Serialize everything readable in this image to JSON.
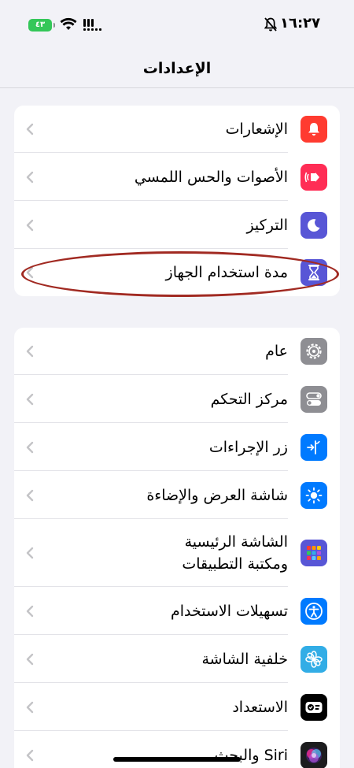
{
  "status": {
    "time": "١٦:٢٧",
    "battery": "٤٣"
  },
  "nav": {
    "title": "الإعدادات"
  },
  "groups": [
    {
      "items": [
        {
          "label": "الإشعارات",
          "icon": "bell-icon",
          "color": "#ff3b30"
        },
        {
          "label": "الأصوات والحس اللمسي",
          "icon": "speaker-icon",
          "color": "#ff2d55"
        },
        {
          "label": "التركيز",
          "icon": "moon-icon",
          "color": "#5856d6"
        },
        {
          "label": "مدة استخدام الجهاز",
          "icon": "hourglass-icon",
          "color": "#5856d6"
        }
      ]
    },
    {
      "items": [
        {
          "label": "عام",
          "icon": "gear-icon",
          "color": "#8e8e93"
        },
        {
          "label": "مركز التحكم",
          "icon": "toggles-icon",
          "color": "#8e8e93"
        },
        {
          "label": "زر الإجراءات",
          "icon": "action-button-icon",
          "color": "#007aff"
        },
        {
          "label": "شاشة العرض والإضاءة",
          "icon": "sun-icon",
          "color": "#007aff"
        },
        {
          "label": "الشاشة الرئيسية ومكتبة التطبيقات",
          "icon": "app-grid-icon",
          "color": "#5856d6"
        },
        {
          "label": "تسهيلات الاستخدام",
          "icon": "accessibility-icon",
          "color": "#007aff"
        },
        {
          "label": "خلفية الشاشة",
          "icon": "flower-icon",
          "color": "#32ade6"
        },
        {
          "label": "الاستعداد",
          "icon": "standby-icon",
          "color": "#000000"
        },
        {
          "label": "Siri والبحث",
          "icon": "siri-icon",
          "color": "#1c1c1e"
        }
      ]
    }
  ]
}
